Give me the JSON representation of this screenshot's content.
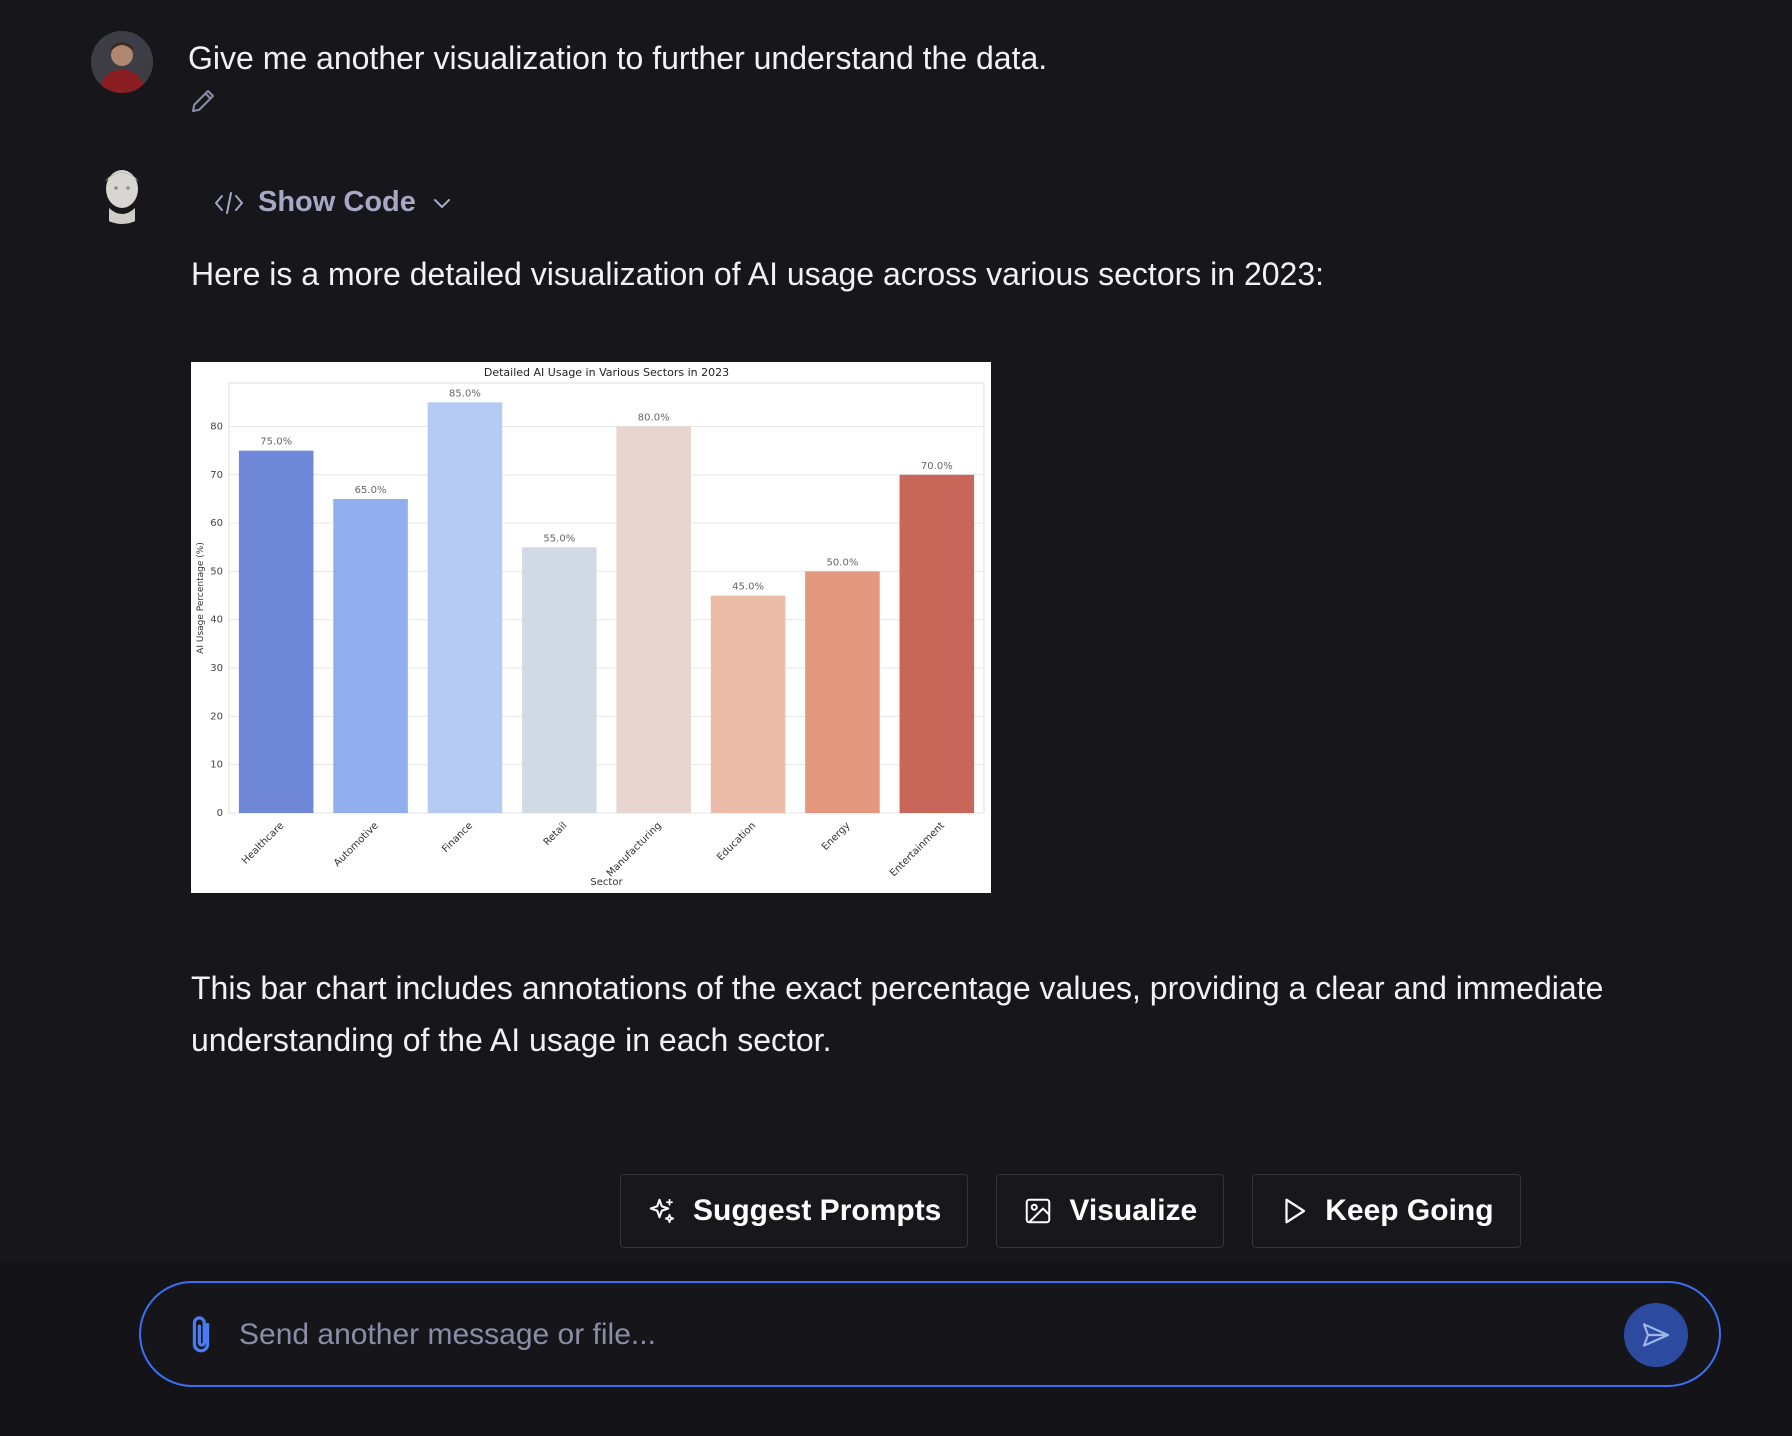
{
  "user_message": {
    "text": "Give me another visualization to further understand the data.",
    "edit_icon": "pencil-icon"
  },
  "assistant": {
    "show_code_label": "Show Code",
    "intro": "Here is a more detailed visualization of AI usage across various sectors in 2023:",
    "outro": "This bar chart includes annotations of the exact percentage values, providing a clear and immediate understanding of the AI usage in each sector."
  },
  "actions": {
    "suggest": "Suggest Prompts",
    "visualize": "Visualize",
    "keep_going": "Keep Going"
  },
  "composer": {
    "placeholder": "Send another message or file...",
    "accent": "#3b6ff2"
  },
  "chart_data": {
    "type": "bar",
    "title": "Detailed AI Usage in Various Sectors in 2023",
    "xlabel": "Sector",
    "ylabel": "AI Usage Percentage (%)",
    "categories": [
      "Healthcare",
      "Automotive",
      "Finance",
      "Retail",
      "Manufacturing",
      "Education",
      "Energy",
      "Entertainment"
    ],
    "values": [
      75,
      65,
      85,
      55,
      80,
      45,
      50,
      70
    ],
    "data_labels": [
      "75.0%",
      "65.0%",
      "85.0%",
      "55.0%",
      "80.0%",
      "45.0%",
      "50.0%",
      "70.0%"
    ],
    "colors": [
      "#6f88d8",
      "#91aeef",
      "#b6cbf3",
      "#d1dbe6",
      "#e8d5cf",
      "#edbca8",
      "#e49880",
      "#c8665a"
    ],
    "ylim": [
      0,
      89
    ],
    "yticks": [
      0,
      10,
      20,
      30,
      40,
      50,
      60,
      70,
      80
    ],
    "grid": true
  }
}
